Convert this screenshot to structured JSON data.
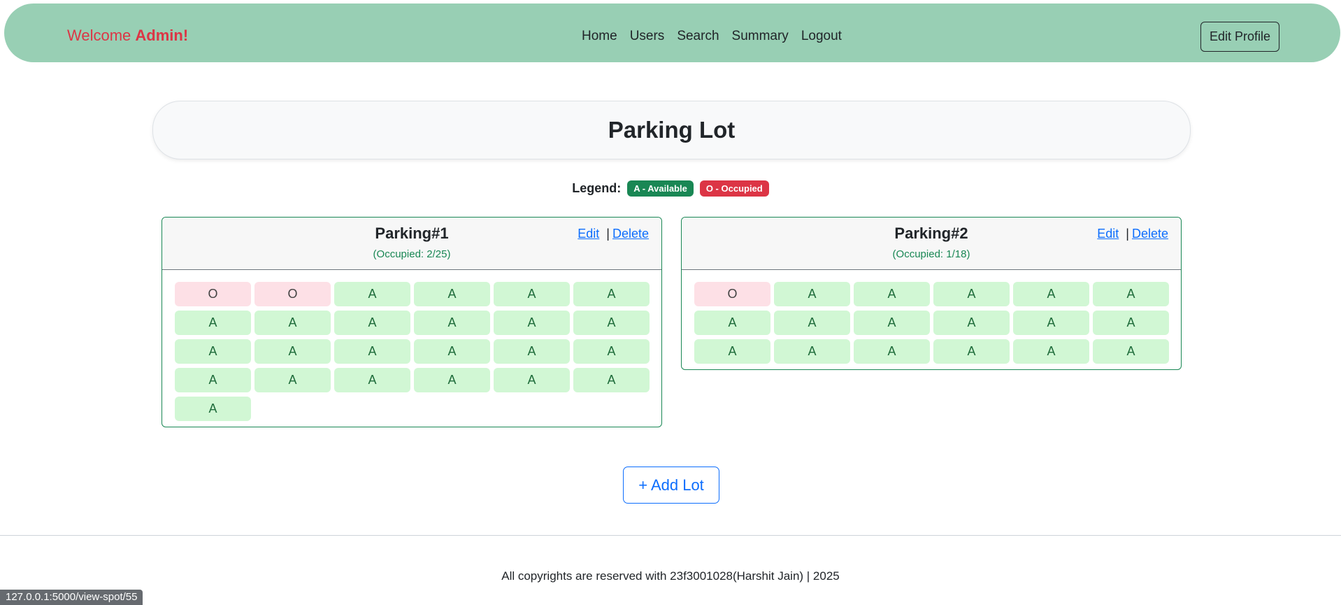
{
  "navbar": {
    "welcome_prefix": "Welcome",
    "welcome_name": "Admin!",
    "links": [
      "Home",
      "Users",
      "Search",
      "Summary",
      "Logout"
    ],
    "edit_profile_label": "Edit Profile"
  },
  "page_title": "Parking Lot",
  "legend": {
    "label": "Legend:",
    "available": "A - Available",
    "occupied": "O - Occupied"
  },
  "lots": [
    {
      "name": "Parking#1",
      "occupancy": "(Occupied: 2/25)",
      "edit_label": "Edit",
      "delete_label": "Delete",
      "spots": [
        "O",
        "O",
        "A",
        "A",
        "A",
        "A",
        "A",
        "A",
        "A",
        "A",
        "A",
        "A",
        "A",
        "A",
        "A",
        "A",
        "A",
        "A",
        "A",
        "A",
        "A",
        "A",
        "A",
        "A",
        "A"
      ]
    },
    {
      "name": "Parking#2",
      "occupancy": "(Occupied: 1/18)",
      "edit_label": "Edit",
      "delete_label": "Delete",
      "spots": [
        "O",
        "A",
        "A",
        "A",
        "A",
        "A",
        "A",
        "A",
        "A",
        "A",
        "A",
        "A",
        "A",
        "A",
        "A",
        "A",
        "A",
        "A"
      ]
    }
  ],
  "add_lot_label": "+ Add Lot",
  "footer_text": "All copyrights are reserved with 23f3001028(Harshit Jain) | 2025",
  "status_url": "127.0.0.1:5000/view-spot/55",
  "colors": {
    "navbar": "#98cfb4",
    "welcome": "#dc3545",
    "available_bg": "#d1f7d4",
    "occupied_bg": "#fde0e6",
    "card_border": "#198754"
  }
}
